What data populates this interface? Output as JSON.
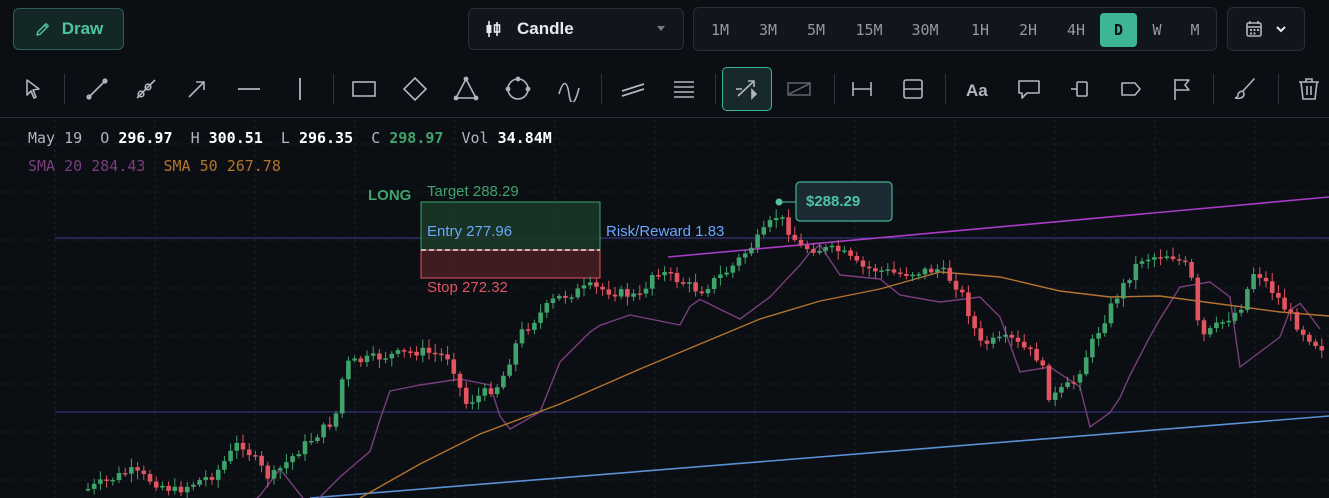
{
  "toolbar": {
    "draw_label": "Draw",
    "chart_type": "Candle",
    "timeframes": [
      "1M",
      "3M",
      "5M",
      "15M",
      "30M",
      "1H",
      "2H",
      "4H",
      "D",
      "W",
      "M"
    ],
    "active_timeframe": "D"
  },
  "legend": {
    "date": "May 19",
    "o_label": "O",
    "o": "296.97",
    "h_label": "H",
    "h": "300.51",
    "l_label": "L",
    "l": "296.35",
    "c_label": "C",
    "c": "298.97",
    "vol_label": "Vol",
    "vol": "34.84M",
    "sma20_label": "SMA 20",
    "sma20": "284.43",
    "sma50_label": "SMA 50",
    "sma50": "267.78"
  },
  "position": {
    "type_label": "LONG",
    "target_label": "Target 288.29",
    "entry_label": "Entry 277.96",
    "stop_label": "Stop 272.32",
    "rr_label": "Risk/Reward 1.83"
  },
  "price_tag": "$288.29",
  "colors": {
    "accent": "#3fb597",
    "up": "#3fa36b",
    "down": "#e2545f",
    "sma20": "#7a3f7e",
    "sma50": "#b5742f",
    "target_zone": "#1b3a27",
    "stop_zone": "#4a1f24"
  },
  "icons": {
    "draw": "pencil-icon",
    "chart_type": "candle-icon",
    "calendar": "calendar-icon",
    "tools": [
      "cursor-icon",
      "trendline-icon",
      "ray-icon",
      "arrow-icon",
      "horizontal-line-icon",
      "vertical-line-icon",
      "rectangle-icon",
      "rotated-rectangle-icon",
      "triangle-icon",
      "circle-icon",
      "curve-icon",
      "parallel-channel-icon",
      "fib-retracement-icon",
      "long-position-icon",
      "short-position-icon",
      "price-range-icon",
      "date-range-icon",
      "text-icon",
      "callout-icon",
      "price-label-icon",
      "tag-icon",
      "flag-icon",
      "brush-icon",
      "trash-icon"
    ]
  }
}
